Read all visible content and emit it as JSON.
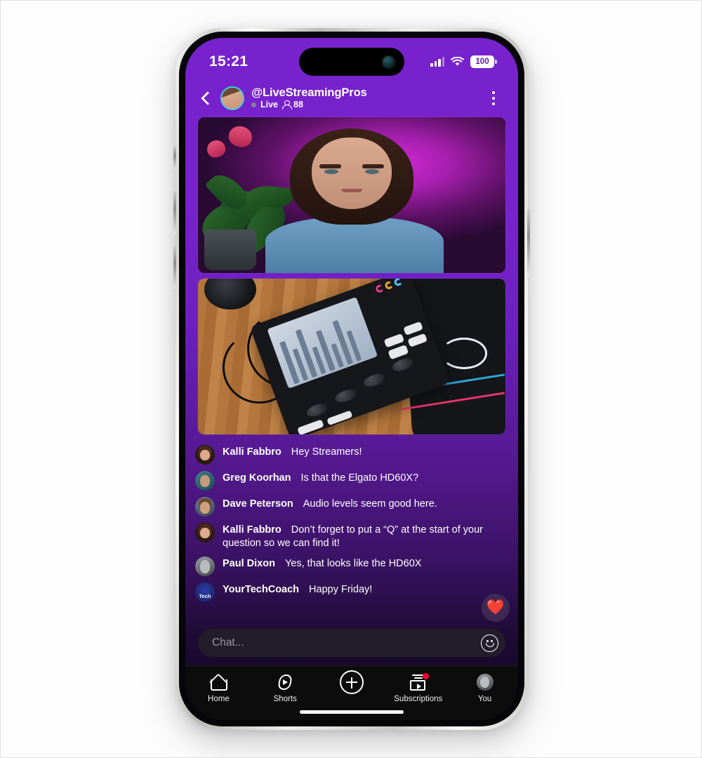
{
  "status_bar": {
    "time": "15:21",
    "battery_level": "100",
    "signal_icon": "cellular-signal-icon",
    "wifi_icon": "wifi-icon",
    "battery_icon": "battery-icon"
  },
  "channel_header": {
    "back_icon": "back-chevron-icon",
    "avatar": "channel-avatar",
    "handle": "@LiveStreamingPros",
    "live_label": "Live",
    "viewer_count": "88",
    "viewer_icon": "person-icon",
    "menu_icon": "kebab-menu-icon"
  },
  "video_tiles": [
    {
      "name": "host-video",
      "alt": "Woman in blue sweater on purple lit background with plant"
    },
    {
      "name": "gear-video",
      "alt": "Audio mixer device on wooden desk next to mouse pad"
    }
  ],
  "chat": {
    "messages": [
      {
        "avatar": "av-kalli",
        "name": "Kalli Fabbro",
        "text": "Hey Streamers!"
      },
      {
        "avatar": "av-greg",
        "name": "Greg Koorhan",
        "text": "Is that the Elgato HD60X?"
      },
      {
        "avatar": "av-dave",
        "name": "Dave Peterson",
        "text": "Audio levels seem good here."
      },
      {
        "avatar": "av-kalli",
        "name": "Kalli Fabbro",
        "text": "Don’t forget to put a “Q” at the start of your question so we can find it!"
      },
      {
        "avatar": "av-paul",
        "name": "Paul Dixon",
        "text": "Yes, that looks like the HD60X"
      },
      {
        "avatar": "av-ytc",
        "name": "YourTechCoach",
        "text": "Happy Friday!"
      }
    ],
    "heart_reaction": "❤️",
    "heart_icon": "heart-reaction-icon"
  },
  "chat_input": {
    "placeholder": "Chat...",
    "value": "",
    "emoji_icon": "smiley-emoji-icon"
  },
  "bottom_nav": [
    {
      "label": "Home",
      "icon": "home-icon",
      "badge": false
    },
    {
      "label": "Shorts",
      "icon": "shorts-icon",
      "badge": false
    },
    {
      "label": "",
      "icon": "create-plus-icon",
      "badge": false
    },
    {
      "label": "Subscriptions",
      "icon": "subscriptions-icon",
      "badge": true
    },
    {
      "label": "You",
      "icon": "account-avatar-icon",
      "badge": false
    }
  ],
  "colors": {
    "brand_purple": "#7722CC",
    "accent_cyan": "#35D2DE",
    "badge_red": "#FF0033",
    "nav_background": "#0C0C0C",
    "input_background": "#231D2B"
  }
}
